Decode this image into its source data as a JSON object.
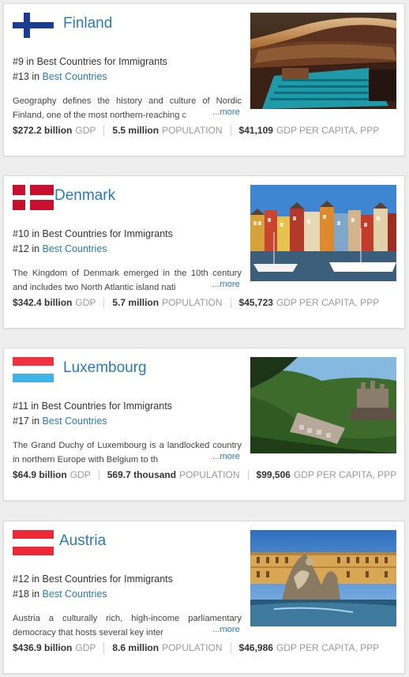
{
  "countries": [
    {
      "name": "Finland",
      "rank1": "#9 in Best Countries for Immigrants",
      "rank2_prefix": "#13 in",
      "rank2_link": "Best Countries",
      "description": "Geography defines the history and culture of Nordic Finland, one of the most northern-reaching c",
      "more_ellipsis": "...",
      "more": "more",
      "gdp": "$272.2 billion",
      "gdp_label": "GDP",
      "population": "5.5 million",
      "population_label": "POPULATION",
      "gdp_per_capita": "$41,109",
      "gdp_per_capita_label": "GDP PER CAPITA, PPP",
      "flag_icon": "finland-flag-icon",
      "photo_icon": "concert-hall-photo"
    },
    {
      "name": "Denmark",
      "rank1": "#10 in Best Countries for Immigrants",
      "rank2_prefix": "#12 in",
      "rank2_link": "Best Countries",
      "description": "The Kingdom of Denmark emerged in the 10th century and includes two North Atlantic island nati",
      "more_ellipsis": "...",
      "more": "more",
      "gdp": "$342.4 billion",
      "gdp_label": "GDP",
      "population": "5.7 million",
      "population_label": "POPULATION",
      "gdp_per_capita": "$45,723",
      "gdp_per_capita_label": "GDP PER CAPITA, PPP",
      "flag_icon": "denmark-flag-icon",
      "photo_icon": "harbor-photo"
    },
    {
      "name": "Luxembourg",
      "rank1": "#11 in Best Countries for Immigrants",
      "rank2_prefix": "#17 in",
      "rank2_link": "Best Countries",
      "description": "The Grand Duchy of Luxembourg is a landlocked country in northern Europe with Belgium to th",
      "more_ellipsis": "...",
      "more": "more",
      "gdp": "$64.9 billion",
      "gdp_label": "GDP",
      "population": "569.7 thousand",
      "population_label": "POPULATION",
      "gdp_per_capita": "$99,506",
      "gdp_per_capita_label": "GDP PER CAPITA, PPP",
      "flag_icon": "luxembourg-flag-icon",
      "photo_icon": "castle-valley-photo"
    },
    {
      "name": "Austria",
      "rank1": "#12 in Best Countries for Immigrants",
      "rank2_prefix": "#18 in",
      "rank2_link": "Best Countries",
      "description": "Austria a culturally rich, high-income parliamentary democracy that hosts several key inter",
      "more_ellipsis": "...",
      "more": "more",
      "gdp": "$436.9 billion",
      "gdp_label": "GDP",
      "population": "8.6 million",
      "population_label": "POPULATION",
      "gdp_per_capita": "$46,986",
      "gdp_per_capita_label": "GDP PER CAPITA, PPP",
      "flag_icon": "austria-flag-icon",
      "photo_icon": "palace-fountain-photo"
    }
  ],
  "colors": {
    "link": "#2a7ab8",
    "finland_blue": "#1b3d8f",
    "denmark_red": "#c8102e",
    "luxembourg_red": "#ef3340",
    "luxembourg_blue": "#3fb3e6",
    "austria_red": "#ed2939"
  }
}
